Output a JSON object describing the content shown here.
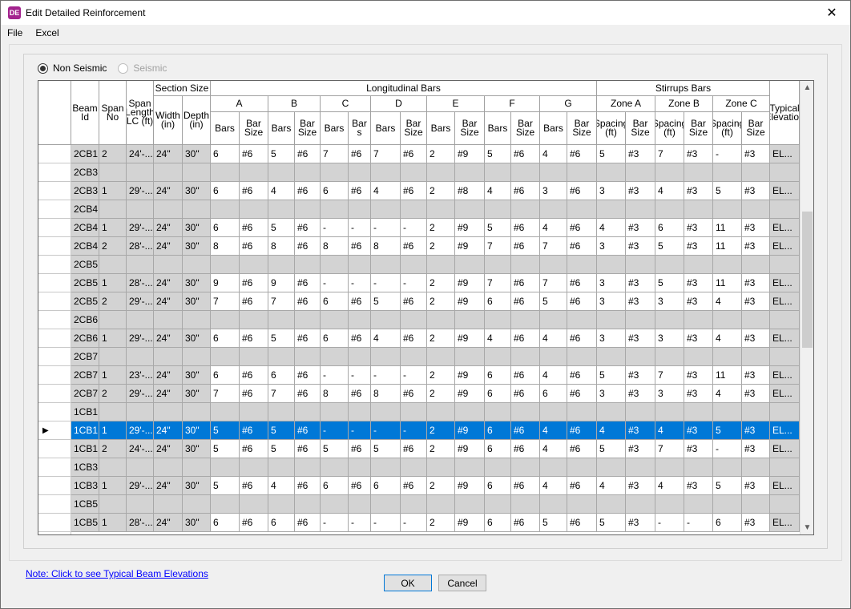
{
  "window": {
    "title": "Edit Detailed Reinforcement",
    "icon_text": "DE",
    "close_glyph": "✕"
  },
  "menu": [
    "File",
    "Excel"
  ],
  "radios": [
    {
      "label": "Non Seismic",
      "selected": true,
      "enabled": true
    },
    {
      "label": "Seismic",
      "selected": false,
      "enabled": false
    }
  ],
  "headers": {
    "beam_id": "Beam Id",
    "span_no": "Span No",
    "span_length": "Span Length LC (ft)",
    "section_size": "Section Size",
    "width": "Width (in)",
    "depth": "Depth (in)",
    "longitudinal": "Longitudinal Bars",
    "stirrups": "Stirrups Bars",
    "typical": "Typical Elevation",
    "groups": [
      "A",
      "B",
      "C",
      "D",
      "E",
      "F",
      "G"
    ],
    "zones": [
      "Zone A",
      "Zone B",
      "Zone C"
    ],
    "bars": "Bars",
    "bar_size": "Bar Size",
    "bar_s": "Bar s",
    "spacing": "Spacing (ft)"
  },
  "rows": [
    {
      "cells": [
        "2CB1",
        "2",
        "24'-...",
        "24\"",
        "30\"",
        "6",
        "#6",
        "5",
        "#6",
        "7",
        "#6",
        "7",
        "#6",
        "2",
        "#9",
        "5",
        "#6",
        "4",
        "#6",
        "5",
        "#3",
        "7",
        "#3",
        "-",
        "#3",
        "EL..."
      ]
    },
    {
      "group": true,
      "cells": [
        "2CB3"
      ]
    },
    {
      "cells": [
        "2CB3",
        "1",
        "29'-...",
        "24\"",
        "30\"",
        "6",
        "#6",
        "4",
        "#6",
        "6",
        "#6",
        "4",
        "#6",
        "2",
        "#8",
        "4",
        "#6",
        "3",
        "#6",
        "3",
        "#3",
        "4",
        "#3",
        "5",
        "#3",
        "EL..."
      ]
    },
    {
      "group": true,
      "cells": [
        "2CB4"
      ]
    },
    {
      "cells": [
        "2CB4",
        "1",
        "29'-...",
        "24\"",
        "30\"",
        "6",
        "#6",
        "5",
        "#6",
        "-",
        "-",
        "-",
        "-",
        "2",
        "#9",
        "5",
        "#6",
        "4",
        "#6",
        "4",
        "#3",
        "6",
        "#3",
        "11",
        "#3",
        "EL..."
      ]
    },
    {
      "cells": [
        "2CB4",
        "2",
        "28'-...",
        "24\"",
        "30\"",
        "8",
        "#6",
        "8",
        "#6",
        "8",
        "#6",
        "8",
        "#6",
        "2",
        "#9",
        "7",
        "#6",
        "7",
        "#6",
        "3",
        "#3",
        "5",
        "#3",
        "11",
        "#3",
        "EL..."
      ]
    },
    {
      "group": true,
      "cells": [
        "2CB5"
      ]
    },
    {
      "cells": [
        "2CB5",
        "1",
        "28'-...",
        "24\"",
        "30\"",
        "9",
        "#6",
        "9",
        "#6",
        "-",
        "-",
        "-",
        "-",
        "2",
        "#9",
        "7",
        "#6",
        "7",
        "#6",
        "3",
        "#3",
        "5",
        "#3",
        "11",
        "#3",
        "EL..."
      ]
    },
    {
      "cells": [
        "2CB5",
        "2",
        "29'-...",
        "24\"",
        "30\"",
        "7",
        "#6",
        "7",
        "#6",
        "6",
        "#6",
        "5",
        "#6",
        "2",
        "#9",
        "6",
        "#6",
        "5",
        "#6",
        "3",
        "#3",
        "3",
        "#3",
        "4",
        "#3",
        "EL..."
      ]
    },
    {
      "group": true,
      "cells": [
        "2CB6"
      ]
    },
    {
      "cells": [
        "2CB6",
        "1",
        "29'-...",
        "24\"",
        "30\"",
        "6",
        "#6",
        "5",
        "#6",
        "6",
        "#6",
        "4",
        "#6",
        "2",
        "#9",
        "4",
        "#6",
        "4",
        "#6",
        "3",
        "#3",
        "3",
        "#3",
        "4",
        "#3",
        "EL..."
      ]
    },
    {
      "group": true,
      "cells": [
        "2CB7"
      ]
    },
    {
      "cells": [
        "2CB7",
        "1",
        "23'-...",
        "24\"",
        "30\"",
        "6",
        "#6",
        "6",
        "#6",
        "-",
        "-",
        "-",
        "-",
        "2",
        "#9",
        "6",
        "#6",
        "4",
        "#6",
        "5",
        "#3",
        "7",
        "#3",
        "11",
        "#3",
        "EL..."
      ]
    },
    {
      "cells": [
        "2CB7",
        "2",
        "29'-...",
        "24\"",
        "30\"",
        "7",
        "#6",
        "7",
        "#6",
        "8",
        "#6",
        "8",
        "#6",
        "2",
        "#9",
        "6",
        "#6",
        "6",
        "#6",
        "3",
        "#3",
        "3",
        "#3",
        "4",
        "#3",
        "EL..."
      ]
    },
    {
      "group": true,
      "cells": [
        "1CB1"
      ]
    },
    {
      "selected": true,
      "cells": [
        "1CB1",
        "1",
        "29'-...",
        "24\"",
        "30\"",
        "5",
        "#6",
        "5",
        "#6",
        "-",
        "-",
        "-",
        "-",
        "2",
        "#9",
        "6",
        "#6",
        "4",
        "#6",
        "4",
        "#3",
        "4",
        "#3",
        "5",
        "#3",
        "EL..."
      ]
    },
    {
      "cells": [
        "1CB1",
        "2",
        "24'-...",
        "24\"",
        "30\"",
        "5",
        "#6",
        "5",
        "#6",
        "5",
        "#6",
        "5",
        "#6",
        "2",
        "#9",
        "6",
        "#6",
        "4",
        "#6",
        "5",
        "#3",
        "7",
        "#3",
        "-",
        "#3",
        "EL..."
      ]
    },
    {
      "group": true,
      "cells": [
        "1CB3"
      ]
    },
    {
      "cells": [
        "1CB3",
        "1",
        "29'-...",
        "24\"",
        "30\"",
        "5",
        "#6",
        "4",
        "#6",
        "6",
        "#6",
        "6",
        "#6",
        "2",
        "#9",
        "6",
        "#6",
        "4",
        "#6",
        "4",
        "#3",
        "4",
        "#3",
        "5",
        "#3",
        "EL..."
      ]
    },
    {
      "group": true,
      "cells": [
        "1CB5"
      ]
    },
    {
      "cells": [
        "1CB5",
        "1",
        "28'-...",
        "24\"",
        "30\"",
        "6",
        "#6",
        "6",
        "#6",
        "-",
        "-",
        "-",
        "-",
        "2",
        "#9",
        "6",
        "#6",
        "5",
        "#6",
        "5",
        "#3",
        "-",
        "-",
        "6",
        "#3",
        "EL..."
      ]
    }
  ],
  "selected_marker": "▶",
  "note_link": "Note: Click to see Typical Beam Elevations",
  "buttons": {
    "ok": "OK",
    "cancel": "Cancel"
  },
  "colors": {
    "selection": "#0078d7",
    "readonly": "#d3d3d3",
    "link": "#0000ff"
  }
}
